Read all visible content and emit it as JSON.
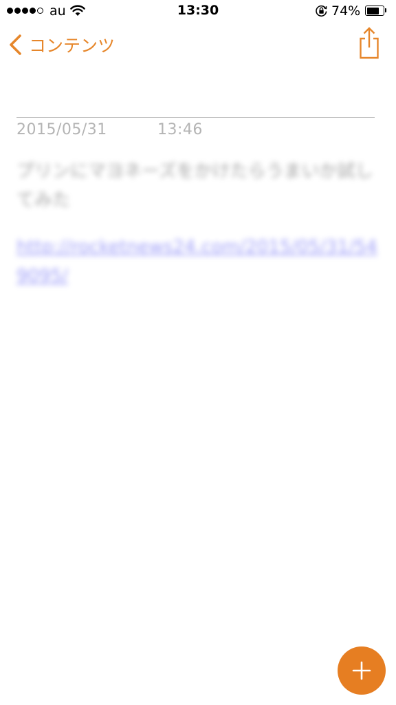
{
  "status_bar": {
    "carrier": "au",
    "time": "13:30",
    "battery_percent": "74%",
    "battery_level": 0.74,
    "signal_bars_filled": 4,
    "signal_bars_total": 5
  },
  "nav": {
    "back_label": "コンテンツ",
    "back_icon": "chevron-left-icon",
    "share_icon": "share-icon"
  },
  "note": {
    "date": "2015/05/31",
    "time": "13:46",
    "body": "プリンにマヨネーズをかけたらうまいか試してみた",
    "link": "http://rocketnews24.com/2015/05/31/549095/"
  },
  "fab": {
    "icon": "plus-icon"
  },
  "colors": {
    "accent": "#E67E22",
    "link": "#6B6BF5",
    "meta_text": "#B4B4B4",
    "divider": "#B9B9B9"
  }
}
